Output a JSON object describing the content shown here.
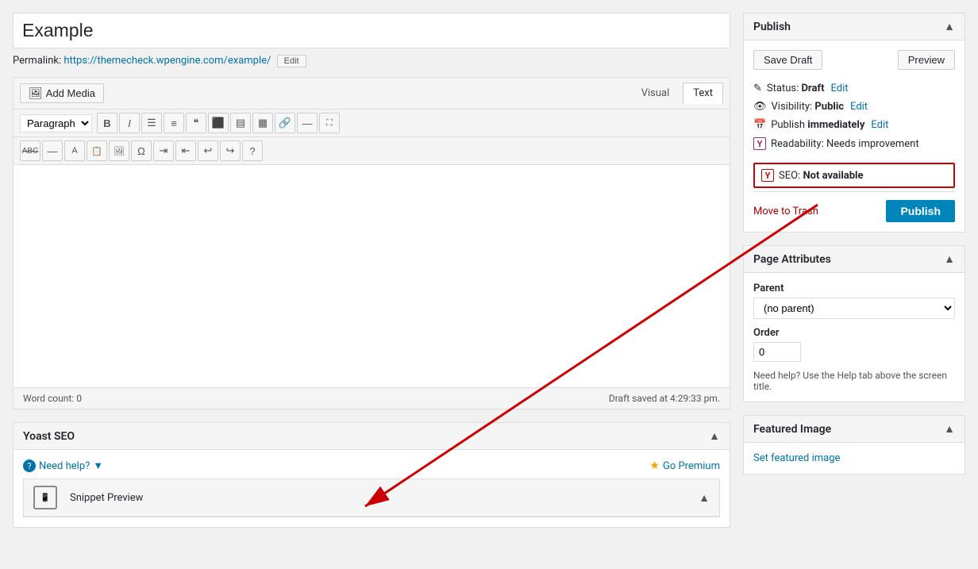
{
  "post": {
    "title": "Example",
    "permalink_label": "Permalink:",
    "permalink_url": "https://themecheck.wpengine.com/example/",
    "edit_label": "Edit"
  },
  "toolbar": {
    "add_media": "Add Media",
    "tab_visual": "Visual",
    "tab_text": "Text",
    "paragraph_label": "Paragraph"
  },
  "editor_footer": {
    "word_count_label": "Word count:",
    "word_count": "0",
    "draft_saved": "Draft saved at 4:29:33 pm."
  },
  "publish_box": {
    "title": "Publish",
    "save_draft": "Save Draft",
    "preview": "Preview",
    "status_label": "Status:",
    "status_value": "Draft",
    "status_edit": "Edit",
    "visibility_label": "Visibility:",
    "visibility_value": "Public",
    "visibility_edit": "Edit",
    "publish_label": "Publish",
    "publish_timing": "immediately",
    "publish_edit": "Edit",
    "readability_label": "Readability:",
    "readability_value": "Needs improvement",
    "seo_label": "SEO:",
    "seo_value": "Not available",
    "move_to_trash": "Move to Trash",
    "publish_btn": "Publish"
  },
  "page_attributes": {
    "title": "Page Attributes",
    "parent_label": "Parent",
    "parent_option": "(no parent)",
    "order_label": "Order",
    "order_value": "0",
    "help_text": "Need help? Use the Help tab above the screen title."
  },
  "featured_image": {
    "title": "Featured Image",
    "set_link": "Set featured image"
  },
  "yoast": {
    "title": "Yoast SEO",
    "need_help": "Need help?",
    "go_premium": "Go Premium",
    "snippet_preview_label": "Snippet Preview"
  }
}
